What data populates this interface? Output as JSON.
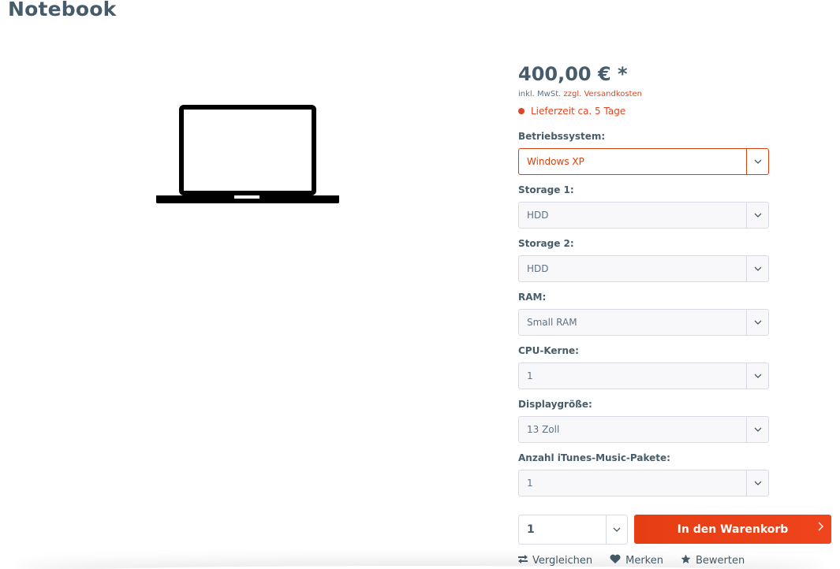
{
  "product": {
    "title": "Notebook",
    "price": "400,00 € *",
    "tax_prefix": "inkl. MwSt. ",
    "shipping_link": "zzgl. Versandkosten",
    "delivery": "Lieferzeit ca. 5 Tage"
  },
  "options": [
    {
      "label": "Betriebssystem:",
      "value": "Windows XP"
    },
    {
      "label": "Storage 1:",
      "value": "HDD"
    },
    {
      "label": "Storage 2:",
      "value": "HDD"
    },
    {
      "label": "RAM:",
      "value": "Small RAM"
    },
    {
      "label": "CPU-Kerne:",
      "value": "1"
    },
    {
      "label": "Displaygröße:",
      "value": "13 Zoll"
    },
    {
      "label": "Anzahl iTunes-Music-Pakete:",
      "value": "1"
    }
  ],
  "quantity": "1",
  "cart_button": "In den Warenkorb",
  "actions": {
    "compare": "Vergleichen",
    "remember": "Merken",
    "rate": "Bewerten"
  },
  "colors": {
    "accent": "#e04621",
    "text": "#475c6a"
  },
  "icons": {
    "product_image": "laptop-icon",
    "dropdown": "chevron-down-icon",
    "compare": "compare-arrows-icon",
    "remember": "heart-icon",
    "rate": "star-icon"
  }
}
